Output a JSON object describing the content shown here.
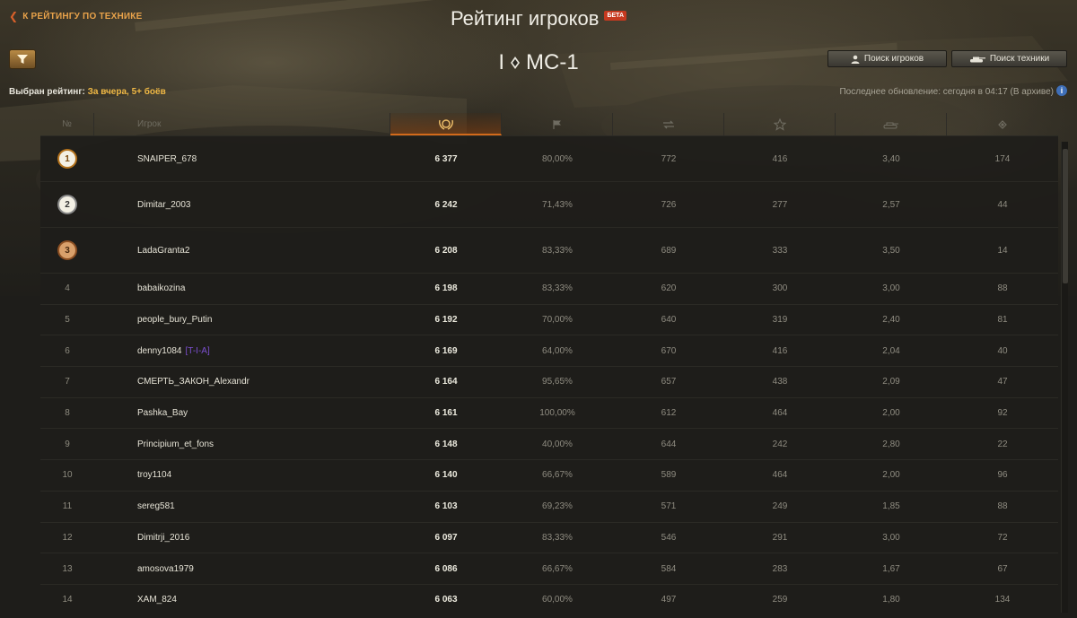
{
  "header": {
    "back_label": "К РЕЙТИНГУ ПО ТЕХНИКЕ",
    "title": "Рейтинг игроков",
    "beta_badge": "БЕТА"
  },
  "vehicle": {
    "tier": "I",
    "name": "МС-1"
  },
  "buttons": {
    "search_players": "Поиск игроков",
    "search_vehicles": "Поиск техники"
  },
  "selected_rating": {
    "label": "Выбран рейтинг:",
    "value": "За вчера, 5+ боёв"
  },
  "last_update": "Последнее обновление: сегодня в 04:17 (В архиве)",
  "table": {
    "headers": {
      "num": "№",
      "player": "Игрок",
      "icons": [
        "rating-laurel-icon",
        "flag-icon",
        "damage-icon",
        "star-icon",
        "tank-icon",
        "spotting-icon"
      ]
    },
    "rows": [
      {
        "rank": "1",
        "name": "SNAIPER_678",
        "clan": "",
        "rating": "6 377",
        "winrate": "80,00%",
        "damage": "772",
        "xp": "416",
        "frags": "3,40",
        "assist": "174"
      },
      {
        "rank": "2",
        "name": "Dimitar_2003",
        "clan": "",
        "rating": "6 242",
        "winrate": "71,43%",
        "damage": "726",
        "xp": "277",
        "frags": "2,57",
        "assist": "44"
      },
      {
        "rank": "3",
        "name": "LadaGranta2",
        "clan": "",
        "rating": "6 208",
        "winrate": "83,33%",
        "damage": "689",
        "xp": "333",
        "frags": "3,50",
        "assist": "14"
      },
      {
        "rank": "4",
        "name": "babaikozina",
        "clan": "",
        "rating": "6 198",
        "winrate": "83,33%",
        "damage": "620",
        "xp": "300",
        "frags": "3,00",
        "assist": "88"
      },
      {
        "rank": "5",
        "name": "people_bury_Putin",
        "clan": "",
        "rating": "6 192",
        "winrate": "70,00%",
        "damage": "640",
        "xp": "319",
        "frags": "2,40",
        "assist": "81"
      },
      {
        "rank": "6",
        "name": "denny1084",
        "clan": "[T-I-A]",
        "rating": "6 169",
        "winrate": "64,00%",
        "damage": "670",
        "xp": "416",
        "frags": "2,04",
        "assist": "40"
      },
      {
        "rank": "7",
        "name": "СМЕРТЬ_ЗАКОН_Alexandr",
        "clan": "",
        "rating": "6 164",
        "winrate": "95,65%",
        "damage": "657",
        "xp": "438",
        "frags": "2,09",
        "assist": "47"
      },
      {
        "rank": "8",
        "name": "Pashka_Bay",
        "clan": "",
        "rating": "6 161",
        "winrate": "100,00%",
        "damage": "612",
        "xp": "464",
        "frags": "2,00",
        "assist": "92"
      },
      {
        "rank": "9",
        "name": "Principium_et_fons",
        "clan": "",
        "rating": "6 148",
        "winrate": "40,00%",
        "damage": "644",
        "xp": "242",
        "frags": "2,80",
        "assist": "22"
      },
      {
        "rank": "10",
        "name": "troy1104",
        "clan": "",
        "rating": "6 140",
        "winrate": "66,67%",
        "damage": "589",
        "xp": "464",
        "frags": "2,00",
        "assist": "96"
      },
      {
        "rank": "11",
        "name": "sereg581",
        "clan": "",
        "rating": "6 103",
        "winrate": "69,23%",
        "damage": "571",
        "xp": "249",
        "frags": "1,85",
        "assist": "88"
      },
      {
        "rank": "12",
        "name": "Dimitrji_2016",
        "clan": "",
        "rating": "6 097",
        "winrate": "83,33%",
        "damage": "546",
        "xp": "291",
        "frags": "3,00",
        "assist": "72"
      },
      {
        "rank": "13",
        "name": "amosova1979",
        "clan": "",
        "rating": "6 086",
        "winrate": "66,67%",
        "damage": "584",
        "xp": "283",
        "frags": "1,67",
        "assist": "67"
      },
      {
        "rank": "14",
        "name": "XAM_824",
        "clan": "",
        "rating": "6 063",
        "winrate": "60,00%",
        "damage": "497",
        "xp": "259",
        "frags": "1,80",
        "assist": "134"
      }
    ]
  },
  "colors": {
    "accent_orange": "#d26a1b",
    "gold_text": "#f1b945",
    "clan_purple": "#7b4fcf",
    "beta_red": "#c6391f"
  }
}
